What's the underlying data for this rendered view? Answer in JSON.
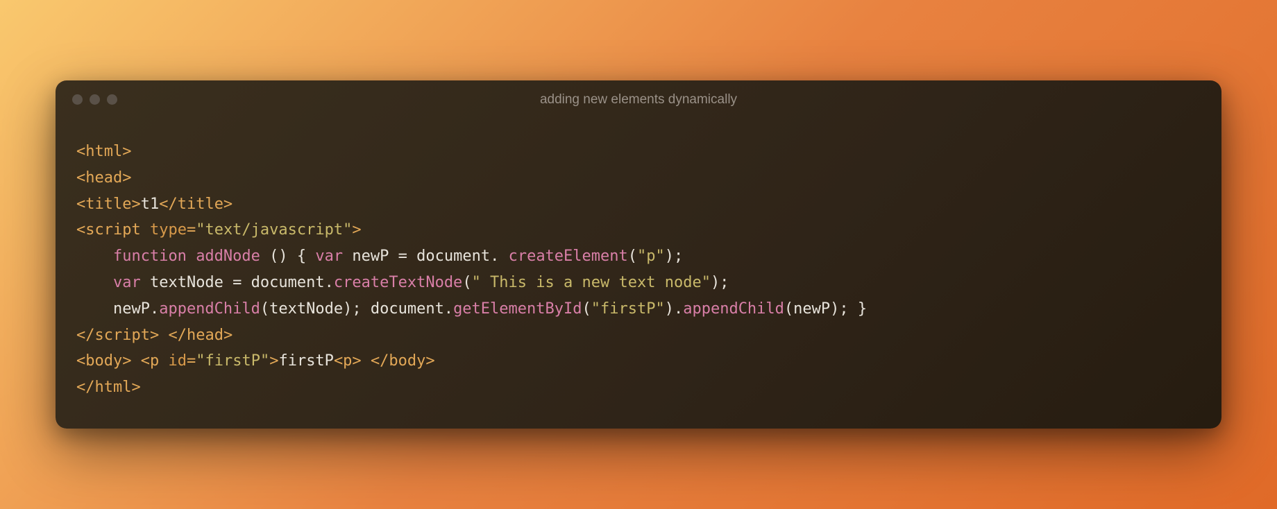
{
  "window": {
    "title": "adding new elements dynamically"
  },
  "colors": {
    "bg_gradient_start": "#f9c86e",
    "bg_gradient_end": "#e06a28",
    "window_bg": "#3a2f1e",
    "tag": "#e3a857",
    "keyword": "#d97fa8",
    "string": "#c9b96a",
    "text": "#e8e4dc"
  },
  "code": {
    "lines": [
      {
        "tokens": [
          {
            "t": "<html>",
            "c": "tag"
          }
        ]
      },
      {
        "tokens": [
          {
            "t": "<head>",
            "c": "tag"
          }
        ]
      },
      {
        "tokens": [
          {
            "t": "<title>",
            "c": "tag"
          },
          {
            "t": "t1",
            "c": "plain"
          },
          {
            "t": "</title>",
            "c": "tag"
          }
        ]
      },
      {
        "tokens": [
          {
            "t": "<script ",
            "c": "tag"
          },
          {
            "t": "type",
            "c": "attr"
          },
          {
            "t": "=",
            "c": "tag"
          },
          {
            "t": "\"text/javascript\"",
            "c": "str"
          },
          {
            "t": ">",
            "c": "tag"
          }
        ]
      },
      {
        "indent": 1,
        "tokens": [
          {
            "t": "function",
            "c": "kw"
          },
          {
            "t": " ",
            "c": "plain"
          },
          {
            "t": "addNode",
            "c": "fn"
          },
          {
            "t": " () { ",
            "c": "plain"
          },
          {
            "t": "var",
            "c": "kw"
          },
          {
            "t": " newP ",
            "c": "plain"
          },
          {
            "t": "=",
            "c": "op"
          },
          {
            "t": " document. ",
            "c": "plain"
          },
          {
            "t": "createElement",
            "c": "fn"
          },
          {
            "t": "(",
            "c": "plain"
          },
          {
            "t": "\"p\"",
            "c": "str"
          },
          {
            "t": ");",
            "c": "plain"
          }
        ]
      },
      {
        "indent": 1,
        "tokens": [
          {
            "t": "var",
            "c": "kw"
          },
          {
            "t": " textNode ",
            "c": "plain"
          },
          {
            "t": "=",
            "c": "op"
          },
          {
            "t": " document.",
            "c": "plain"
          },
          {
            "t": "createTextNode",
            "c": "fn"
          },
          {
            "t": "(",
            "c": "plain"
          },
          {
            "t": "\" This is a new text node\"",
            "c": "str"
          },
          {
            "t": ");",
            "c": "plain"
          }
        ]
      },
      {
        "indent": 1,
        "tokens": [
          {
            "t": "newP.",
            "c": "plain"
          },
          {
            "t": "appendChild",
            "c": "fn"
          },
          {
            "t": "(textNode); document.",
            "c": "plain"
          },
          {
            "t": "getElementById",
            "c": "fn"
          },
          {
            "t": "(",
            "c": "plain"
          },
          {
            "t": "\"firstP\"",
            "c": "str"
          },
          {
            "t": ").",
            "c": "plain"
          },
          {
            "t": "appendChild",
            "c": "fn"
          },
          {
            "t": "(newP); }",
            "c": "plain"
          }
        ]
      },
      {
        "tokens": [
          {
            "t": "</script>",
            "c": "tag"
          },
          {
            "t": " ",
            "c": "plain"
          },
          {
            "t": "</head>",
            "c": "tag"
          }
        ]
      },
      {
        "tokens": [
          {
            "t": "<body>",
            "c": "tag"
          },
          {
            "t": " ",
            "c": "plain"
          },
          {
            "t": "<p ",
            "c": "tag"
          },
          {
            "t": "id",
            "c": "attr"
          },
          {
            "t": "=",
            "c": "tag"
          },
          {
            "t": "\"firstP\"",
            "c": "str"
          },
          {
            "t": ">",
            "c": "tag"
          },
          {
            "t": "firstP",
            "c": "plain"
          },
          {
            "t": "<p>",
            "c": "tag"
          },
          {
            "t": " ",
            "c": "plain"
          },
          {
            "t": "</body>",
            "c": "tag"
          }
        ]
      },
      {
        "tokens": [
          {
            "t": "</html>",
            "c": "tag"
          }
        ]
      }
    ]
  }
}
